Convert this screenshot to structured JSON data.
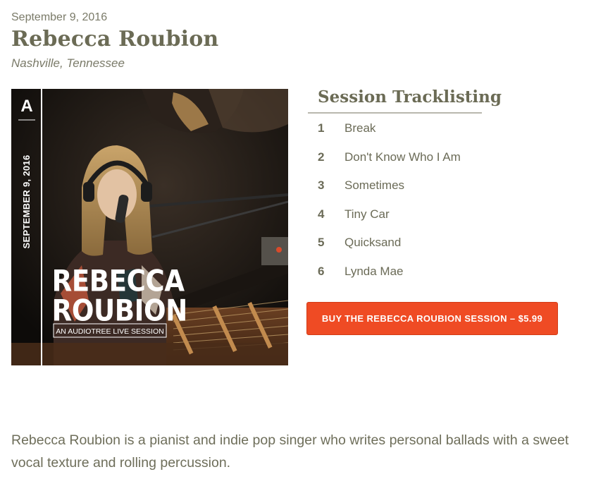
{
  "session": {
    "date": "September 9, 2016",
    "artist": "Rebecca Roubion",
    "location": "Nashville, Tennessee"
  },
  "cover": {
    "logo_letter": "A",
    "vertical_date": "SEPTEMBER 9, 2016",
    "name_line1": "REBECCA",
    "name_line2": "ROUBION",
    "subtitle": "AN AUDIOTREE LIVE SESSION"
  },
  "tracklist": {
    "heading": "Session Tracklisting",
    "tracks": [
      {
        "num": "1",
        "title": "Break"
      },
      {
        "num": "2",
        "title": "Don't Know Who I Am"
      },
      {
        "num": "3",
        "title": "Sometimes"
      },
      {
        "num": "4",
        "title": "Tiny Car"
      },
      {
        "num": "5",
        "title": "Quicksand"
      },
      {
        "num": "6",
        "title": "Lynda Mae"
      }
    ]
  },
  "buy_button": {
    "label": "BUY THE REBECCA ROUBION SESSION – $5.99"
  },
  "description": "Rebecca Roubion is a pianist and indie pop singer who writes personal ballads with a sweet vocal texture and rolling percussion.",
  "colors": {
    "button": "#ef4b24",
    "text": "#6b6b57",
    "rule": "#b9b8ad"
  }
}
